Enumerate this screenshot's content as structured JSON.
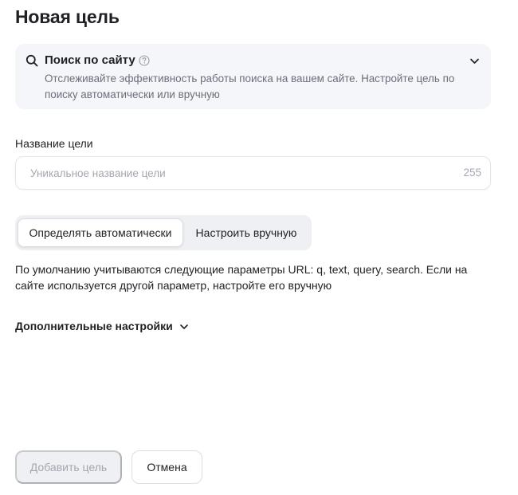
{
  "header": {
    "title": "Новая цель"
  },
  "goal_type": {
    "title": "Поиск по сайту",
    "description": "Отслеживайте эффективность работы поиска на вашем сайте. Настройте цель по поиску автоматически или вручную",
    "icon": "search-icon",
    "help_icon": "question-circle-icon",
    "expand_icon": "chevron-down-icon"
  },
  "name_field": {
    "label": "Название цели",
    "value": "",
    "placeholder": "Уникальное название цели",
    "max_length": "255"
  },
  "mode_switch": {
    "options": [
      {
        "label": "Определять автоматически",
        "selected": true
      },
      {
        "label": "Настроить вручную",
        "selected": false
      }
    ]
  },
  "params_note": "По умолчанию учитываются следующие параметры URL: q, text, query, search. Если на сайте используется другой параметр, настройте его вручную",
  "extra_settings": {
    "label": "Дополнительные настройки"
  },
  "footer": {
    "add_label": "Добавить цель",
    "cancel_label": "Отмена"
  },
  "colors": {
    "text": "#1f2024",
    "muted_text": "#6b6f7a",
    "placeholder": "#a4a7b0",
    "card_bg": "#f5f6f9",
    "switch_bg": "#eff0f3",
    "disabled_button_bg": "#eef0f3"
  }
}
